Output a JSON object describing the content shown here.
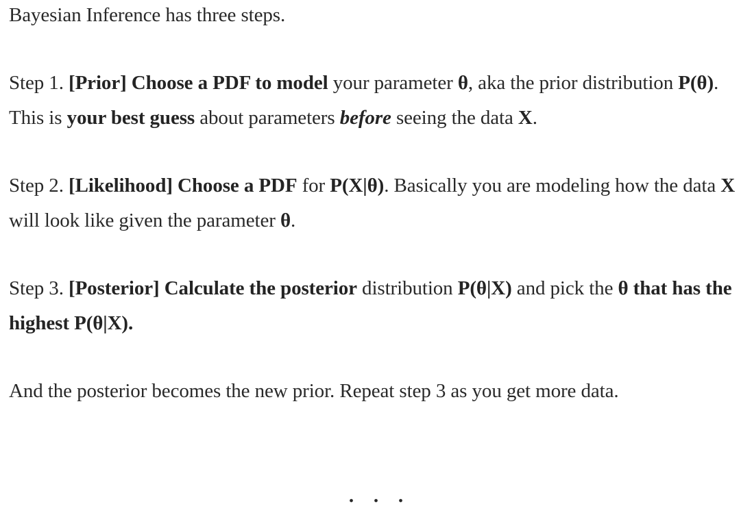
{
  "intro": "Bayesian Inference has three steps.",
  "step1": {
    "prefix": "Step 1. ",
    "bold1": "[Prior] Choose a PDF to model",
    "text1": " your parameter ",
    "bold2": "θ",
    "text2": ", aka the prior distribution ",
    "bold3": "P(θ)",
    "text3": ". This is ",
    "bold4": "your best guess",
    "text4": " about parameters ",
    "bolditalic": "before",
    "text5": " seeing the data ",
    "bold5": "X",
    "text6": "."
  },
  "step2": {
    "prefix": "Step 2. ",
    "bold1": "[Likelihood] Choose a PDF",
    "text1": " for ",
    "bold2": "P(X|θ)",
    "text2": ". Basically you are modeling how the data ",
    "bold3": "X",
    "text3": " will look like given the parameter ",
    "bold4": "θ",
    "text4": "."
  },
  "step3": {
    "prefix": "Step 3. ",
    "bold1": "[Posterior] Calculate the posterior",
    "text1": " distribution ",
    "bold2": "P(θ|X)",
    "text2": " and pick the ",
    "bold3": "θ that has the highest P(θ|X)."
  },
  "closing": "And the posterior becomes the new prior. Repeat step 3 as you get more data.",
  "separator": "..."
}
